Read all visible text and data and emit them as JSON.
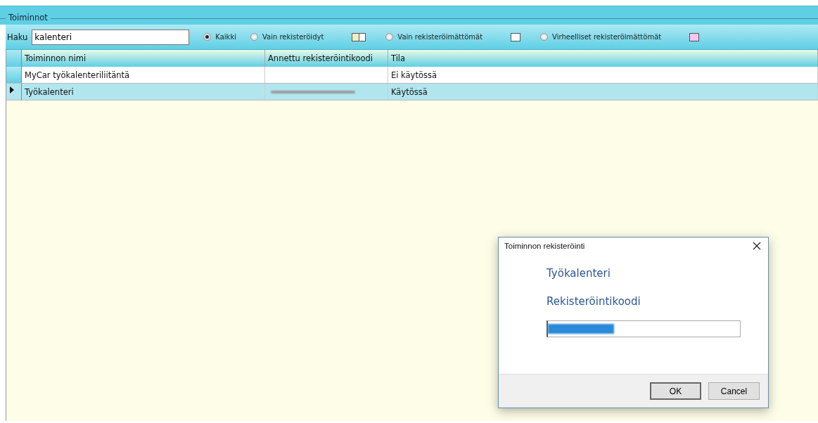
{
  "panel": {
    "title": "Toiminnot"
  },
  "search": {
    "label": "Haku",
    "value": "kalenteri"
  },
  "filters": [
    {
      "label": "Kaikki",
      "selected": true
    },
    {
      "label": "Vain rekisteröidyt",
      "selected": false,
      "swatch": {
        "kind": "split",
        "color": "#f2eec4"
      }
    },
    {
      "label": "Vain rekisteröimättömät",
      "selected": false,
      "swatch": {
        "kind": "plain",
        "color": "#ffffff"
      }
    },
    {
      "label": "Virheelliset rekisteröimättömät",
      "selected": false,
      "swatch": {
        "kind": "plain",
        "color": "#f4c6f0"
      }
    }
  ],
  "table": {
    "columns": [
      "Toiminnon nimi",
      "Annettu rekisteröintikoodi",
      "Tila"
    ],
    "rows": [
      {
        "name": "MyCar työkalenteriliitäntä",
        "code_redacted": false,
        "status": "Ei käytössä",
        "selected": false
      },
      {
        "name": "Työkalenteri",
        "code_redacted": true,
        "status": "Käytössä",
        "selected": true
      }
    ]
  },
  "dialog": {
    "title": "Toiminnon rekisteröinti",
    "heading": "Työkalenteri",
    "field_label": "Rekisteröintikoodi",
    "value_redacted": true,
    "buttons": [
      "OK",
      "Cancel"
    ]
  }
}
